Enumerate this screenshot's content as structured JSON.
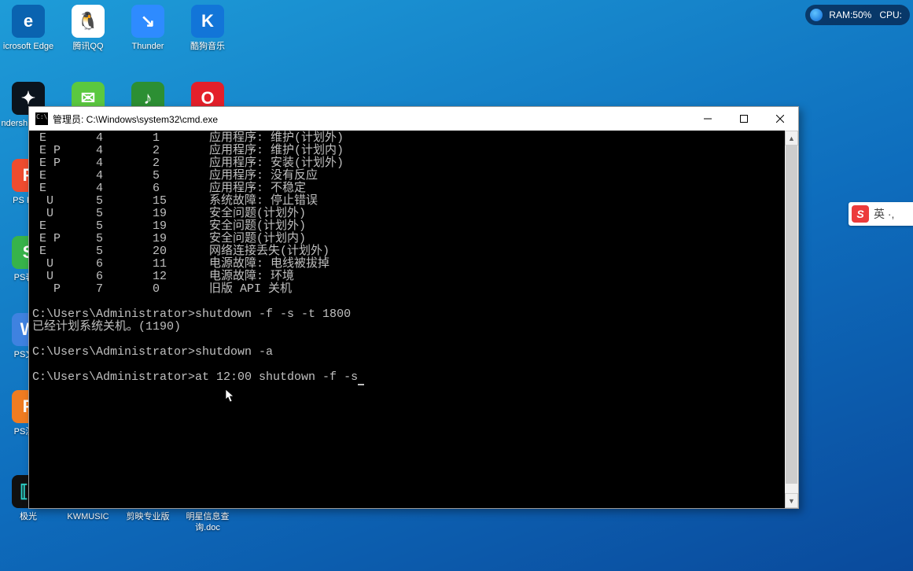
{
  "perf": {
    "ram_label": "RAM:",
    "ram_value": "50%",
    "cpu_label": "CPU:"
  },
  "ime": {
    "logo": "S",
    "label": "英 ·,"
  },
  "desktop_icons": {
    "r0": [
      "icrosoft Edge",
      "腾讯QQ",
      "Thunder",
      "酷狗音乐"
    ],
    "r1": [
      "ndersh covery",
      "",
      "",
      ""
    ],
    "r2": [
      "PS PDF",
      "",
      "",
      ""
    ],
    "r3": [
      "PS表格",
      "",
      "",
      ""
    ],
    "r4": [
      "PS文字",
      "",
      "",
      ""
    ],
    "r5": [
      "PS演示",
      "",
      "",
      ""
    ],
    "r6": [
      "极光",
      "KWMUSIC",
      "剪映专业版",
      "明星信息查询.doc"
    ]
  },
  "cmd": {
    "title": "管理员: C:\\Windows\\system32\\cmd.exe",
    "table_rows": [
      " E       4       1       应用程序: 维护(计划外)",
      " E P     4       2       应用程序: 维护(计划内)",
      " E P     4       2       应用程序: 安装(计划外)",
      " E       4       5       应用程序: 没有反应",
      " E       4       6       应用程序: 不稳定",
      "  U      5       15      系统故障: 停止错误",
      "  U      5       19      安全问题(计划外)",
      " E       5       19      安全问题(计划外)",
      " E P     5       19      安全问题(计划内)",
      " E       5       20      网络连接丢失(计划外)",
      "  U      6       11      电源故障: 电线被拔掉",
      "  U      6       12      电源故障: 环境",
      "   P     7       0       旧版 API 关机"
    ],
    "prompt1": "C:\\Users\\Administrator>",
    "command1": "shutdown -f -s -t 1800",
    "response1": "已经计划系统关机。(1190)",
    "prompt2": "C:\\Users\\Administrator>",
    "command2": "shutdown -a",
    "prompt3": "C:\\Users\\Administrator>",
    "command3": "at 12:00 shutdown -f -s"
  }
}
